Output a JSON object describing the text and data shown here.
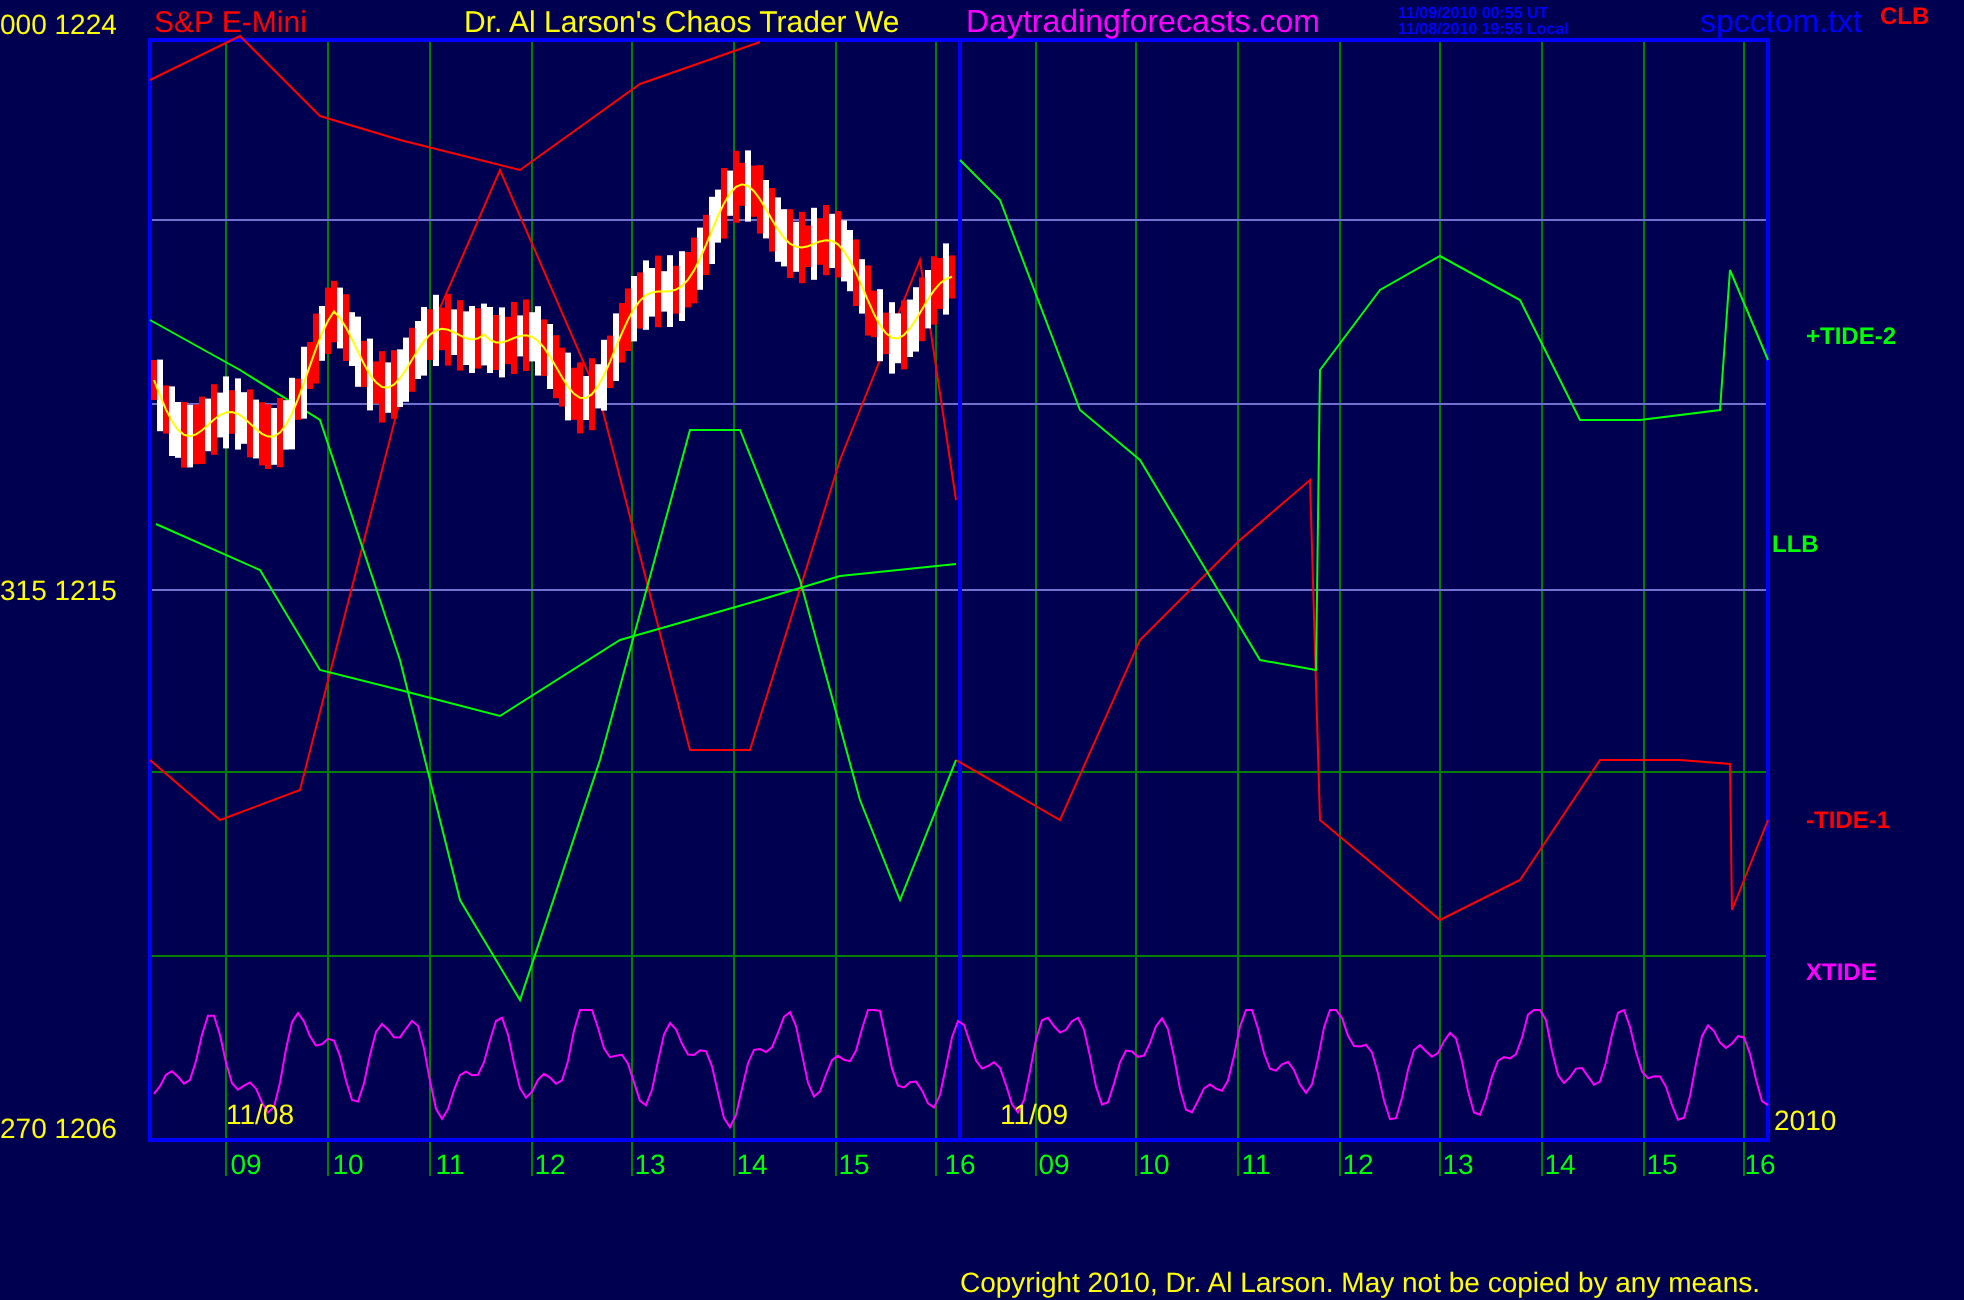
{
  "header": {
    "symbol": "S&P E-Mini",
    "title": "Dr. Al Larson's Chaos Trader We",
    "site": "Daytradingforecasts.com",
    "timestamps": [
      "11/09/2010 00:55 UT",
      "11/08/2010 19:55 Local"
    ],
    "file": "spcctom.txt"
  },
  "chart": {
    "y_labels": [
      "000  1224",
      "315  1215",
      "270  1206"
    ],
    "date_labels": [
      "11/08",
      "11/09"
    ],
    "year": "2010",
    "hour_labels": [
      "09",
      "10",
      "11",
      "12",
      "13",
      "14",
      "15",
      "16",
      "09",
      "10",
      "11",
      "12",
      "13",
      "14",
      "15",
      "16"
    ],
    "series_labels": [
      {
        "text": "CLB",
        "color": "#ff0000"
      },
      {
        "text": "+TIDE-2",
        "color": "#00ff00"
      },
      {
        "text": "LLB",
        "color": "#00ff00"
      },
      {
        "text": "-TIDE-1",
        "color": "#ff0000"
      },
      {
        "text": "XTIDE",
        "color": "#ff00ff"
      }
    ]
  },
  "copyright": "Copyright 2010, Dr. Al Larson. May not be copied by any means."
}
